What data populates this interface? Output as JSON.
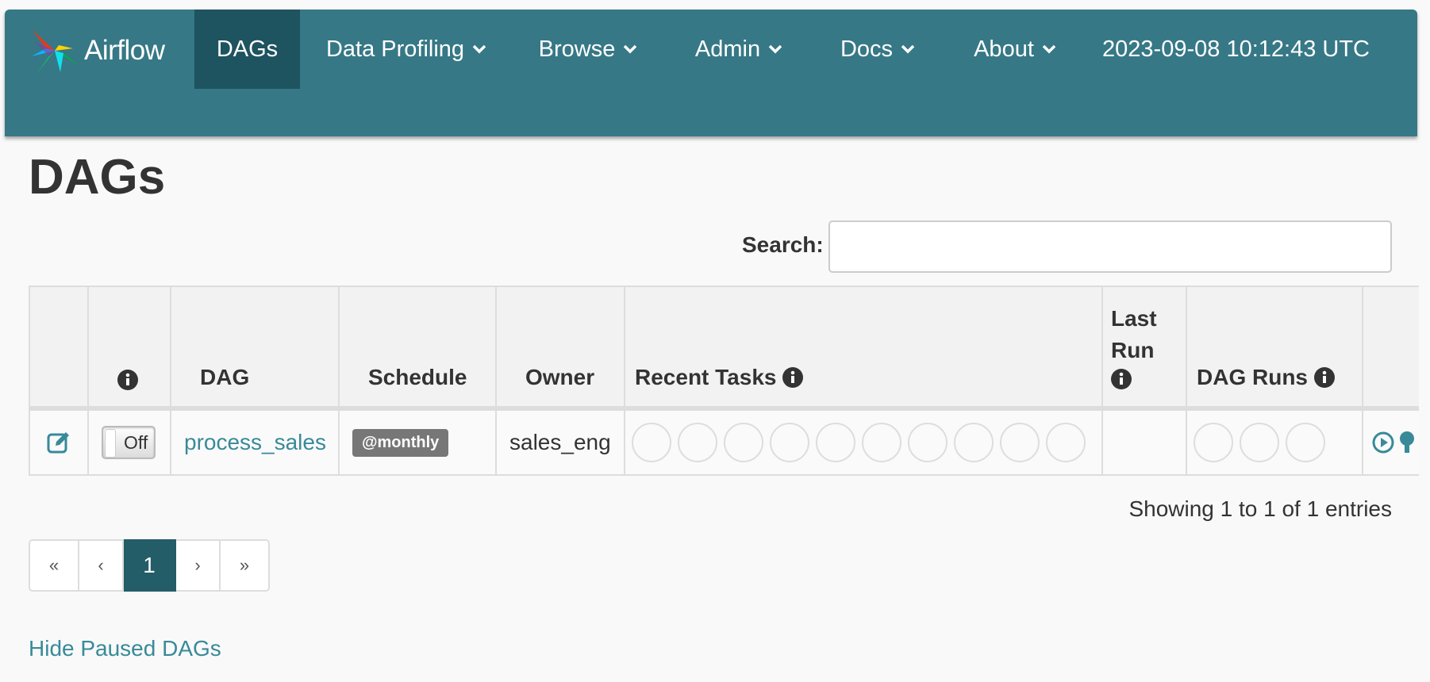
{
  "navbar": {
    "brand": "Airflow",
    "items": [
      {
        "label": "DAGs",
        "active": true
      },
      {
        "label": "Data Profiling",
        "dropdown": true
      },
      {
        "label": "Browse",
        "dropdown": true
      },
      {
        "label": "Admin",
        "dropdown": true
      },
      {
        "label": "Docs",
        "dropdown": true
      },
      {
        "label": "About",
        "dropdown": true
      }
    ],
    "clock": "2023-09-08 10:12:43 UTC",
    "bg_color": "#367886",
    "active_color": "#1e5360"
  },
  "page": {
    "title": "DAGs"
  },
  "search": {
    "label": "Search:",
    "value": "",
    "placeholder": ""
  },
  "table": {
    "headers": {
      "dag": "DAG",
      "schedule": "Schedule",
      "owner": "Owner",
      "recent_tasks": "Recent Tasks",
      "last_run_1": "Last",
      "last_run_2": "Run",
      "dag_runs": "DAG Runs"
    },
    "rows": [
      {
        "toggle": "Off",
        "dag": "process_sales",
        "schedule": "@monthly",
        "owner": "sales_eng",
        "recent_task_slots": 10,
        "dag_run_slots": 3,
        "last_run": ""
      }
    ]
  },
  "showing": "Showing 1 to 1 of 1 entries",
  "pagination": {
    "first": "«",
    "prev": "‹",
    "current": "1",
    "next": "›",
    "last": "»"
  },
  "hide_paused": "Hide Paused DAGs",
  "icons": {
    "edit": "edit-icon",
    "info": "info-icon",
    "trigger": "play-circle-icon",
    "tree": "tree-icon",
    "logo": "pinwheel-logo"
  }
}
